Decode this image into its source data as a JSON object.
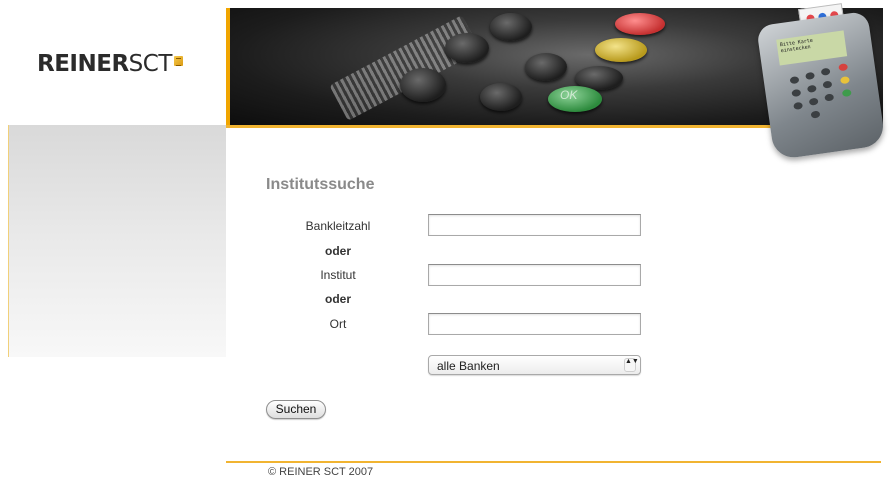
{
  "brand": {
    "logo_bold": "REINER",
    "logo_thin": "SCT"
  },
  "banner": {
    "keypad_ok_label": "OK",
    "reader_screen_text": "Bitte Karte einstecken"
  },
  "form": {
    "title": "Institutssuche",
    "fields": [
      {
        "label": "Bankleitzahl",
        "value": "",
        "placeholder": ""
      },
      {
        "label": "Institut",
        "value": "",
        "placeholder": ""
      },
      {
        "label": "Ort",
        "value": "",
        "placeholder": ""
      }
    ],
    "separators": [
      "oder",
      "oder"
    ],
    "bank_select": {
      "selected": "alle Banken",
      "arrows": "▲▼"
    },
    "submit_label": "Suchen"
  },
  "footer": {
    "copyright": "© REINER SCT 2007"
  },
  "colors": {
    "accent": "#f1b431",
    "title_gray": "#8a8a8a"
  }
}
